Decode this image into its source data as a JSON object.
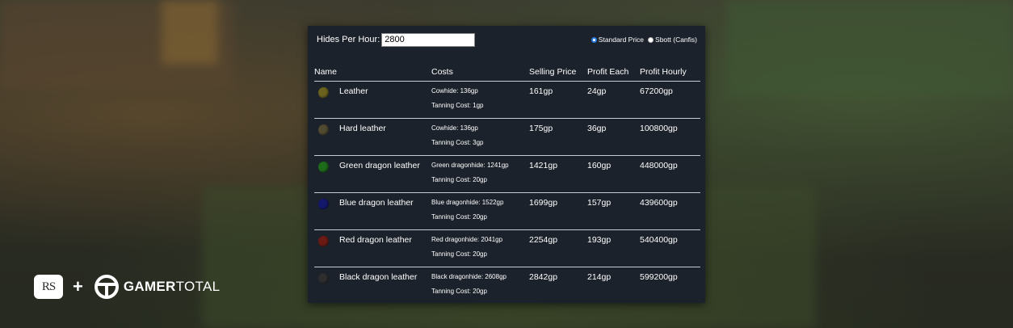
{
  "background": {
    "tint_colors": [
      "#3a3a2e",
      "#262a20",
      "#6e5a34",
      "#4e6a3c"
    ]
  },
  "controls": {
    "hides_label": "Hides Per Hour:",
    "hides_value": "2800",
    "radio_standard": "Standard Price",
    "radio_sbott": "Sbott (Canfis)",
    "selected": "Standard Price"
  },
  "table": {
    "headers": [
      "Name",
      "Costs",
      "Selling Price",
      "Profit Each",
      "Profit Hourly"
    ],
    "rows": [
      {
        "icon": "leather-icon",
        "color": "#6b6220",
        "name": "Leather",
        "cost1": "Cowhide: 136gp",
        "cost2": "Tanning Cost: 1gp",
        "sell": "161gp",
        "each": "24gp",
        "hourly": "67200gp"
      },
      {
        "icon": "hard-leather-icon",
        "color": "#4f4a30",
        "name": "Hard leather",
        "cost1": "Cowhide: 136gp",
        "cost2": "Tanning Cost: 3gp",
        "sell": "175gp",
        "each": "36gp",
        "hourly": "100800gp"
      },
      {
        "icon": "green-dragon-leather-icon",
        "color": "#1e6b1a",
        "name": "Green dragon leather",
        "cost1": "Green dragonhide: 1241gp",
        "cost2": "Tanning Cost: 20gp",
        "sell": "1421gp",
        "each": "160gp",
        "hourly": "448000gp"
      },
      {
        "icon": "blue-dragon-leather-icon",
        "color": "#14186b",
        "name": "Blue dragon leather",
        "cost1": "Blue dragonhide: 1522gp",
        "cost2": "Tanning Cost: 20gp",
        "sell": "1699gp",
        "each": "157gp",
        "hourly": "439600gp"
      },
      {
        "icon": "red-dragon-leather-icon",
        "color": "#6b1a14",
        "name": "Red dragon leather",
        "cost1": "Red dragonhide: 2041gp",
        "cost2": "Tanning Cost: 20gp",
        "sell": "2254gp",
        "each": "193gp",
        "hourly": "540400gp"
      },
      {
        "icon": "black-dragon-leather-icon",
        "color": "#2e2e2e",
        "name": "Black dragon leather",
        "cost1": "Black dragonhide: 2608gp",
        "cost2": "Tanning Cost: 20gp",
        "sell": "2842gp",
        "each": "214gp",
        "hourly": "599200gp"
      }
    ]
  },
  "branding": {
    "rs_logo": "RS",
    "plus": "+",
    "gt_icon": "gamertotal-icon",
    "gt_bold": "GAMER",
    "gt_light": "TOTAL"
  }
}
